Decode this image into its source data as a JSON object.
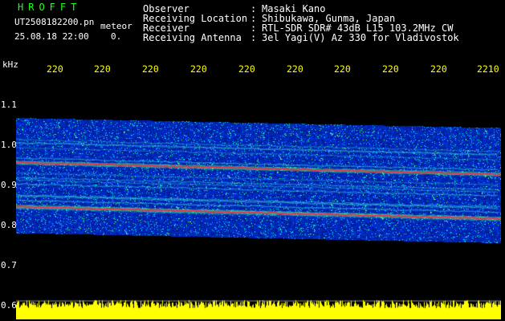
{
  "header": {
    "brand": "HROFFT",
    "filename": "UT2508182200.pn",
    "meteor_label": "meteor",
    "timestamp": "25.08.18 22:00",
    "counter": "0.",
    "info": [
      {
        "label": "Observer",
        "value": "Masaki Kano"
      },
      {
        "label": "Receiving Location",
        "value": "Shibukawa, Gunma, Japan"
      },
      {
        "label": "Receiver",
        "value": "RTL-SDR SDR# 43dB L15 103.2MHz CW"
      },
      {
        "label": "Receiving Antenna",
        "value": "3el Yagi(V) Az 330 for Vladivostok"
      }
    ],
    "colon": ":"
  },
  "chart_data": {
    "type": "heatmap",
    "ylabel": "kHz",
    "yticks": [
      "1.1",
      "1.0",
      "0.9",
      "0.8",
      "0.7",
      "0.6"
    ],
    "ylim": [
      0.6,
      1.1
    ],
    "xticks": [
      "220",
      "220",
      "220",
      "220",
      "220",
      "220",
      "220",
      "220",
      "220",
      "2210"
    ],
    "traces": [
      {
        "name": "",
        "y_start": 0.955,
        "y_end": 0.925
      },
      {
        "name": "",
        "y_start": 0.845,
        "y_end": 0.815
      }
    ],
    "band": {
      "y_top_start": 1.065,
      "y_top_end": 1.04,
      "y_bottom_start": 0.78,
      "y_bottom_end": 0.755
    }
  },
  "colors": {
    "background": "#000000",
    "header_green": "#22ff22",
    "tick_yellow": "#ffff00",
    "noise_blue": "#0a2cd0",
    "trace_red": "#ff2244",
    "signal_green": "#33ff88"
  }
}
